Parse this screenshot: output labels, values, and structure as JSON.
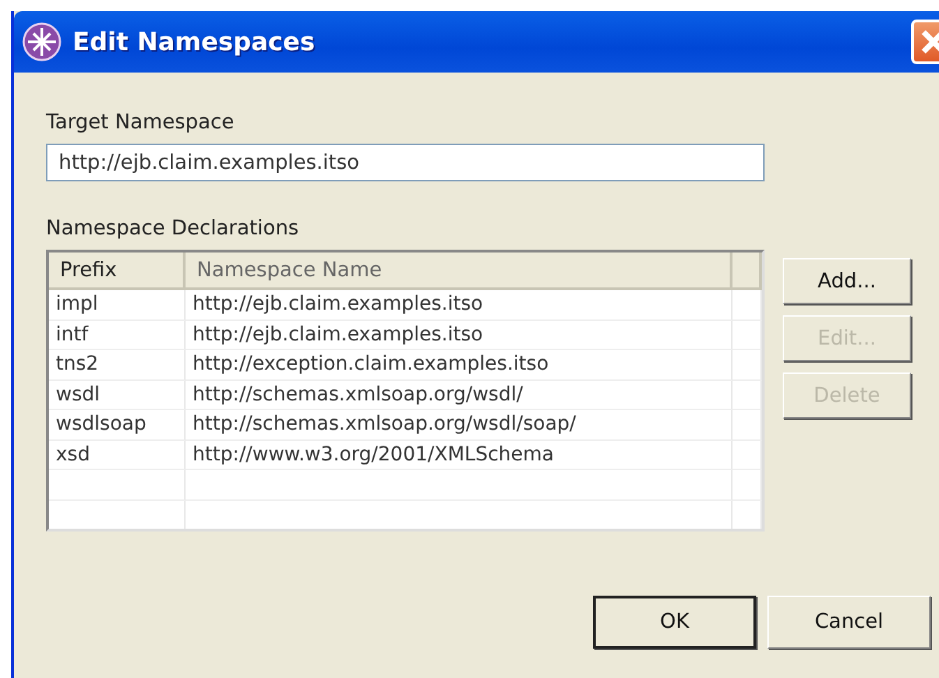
{
  "window": {
    "title": "Edit Namespaces"
  },
  "target_namespace": {
    "label": "Target Namespace",
    "value": "http://ejb.claim.examples.itso"
  },
  "declarations": {
    "label": "Namespace Declarations",
    "columns": [
      "Prefix",
      "Namespace Name"
    ],
    "rows": [
      {
        "prefix": "impl",
        "name": "http://ejb.claim.examples.itso"
      },
      {
        "prefix": "intf",
        "name": "http://ejb.claim.examples.itso"
      },
      {
        "prefix": "tns2",
        "name": "http://exception.claim.examples.itso"
      },
      {
        "prefix": "wsdl",
        "name": "http://schemas.xmlsoap.org/wsdl/"
      },
      {
        "prefix": "wsdlsoap",
        "name": "http://schemas.xmlsoap.org/wsdl/soap/"
      },
      {
        "prefix": "xsd",
        "name": "http://www.w3.org/2001/XMLSchema"
      }
    ]
  },
  "side_buttons": [
    {
      "label": "Add...",
      "disabled": false
    },
    {
      "label": "Edit...",
      "disabled": true
    },
    {
      "label": "Delete",
      "disabled": true
    }
  ],
  "buttons": [
    {
      "label": "OK",
      "default": true
    },
    {
      "label": "Cancel",
      "default": false
    }
  ]
}
